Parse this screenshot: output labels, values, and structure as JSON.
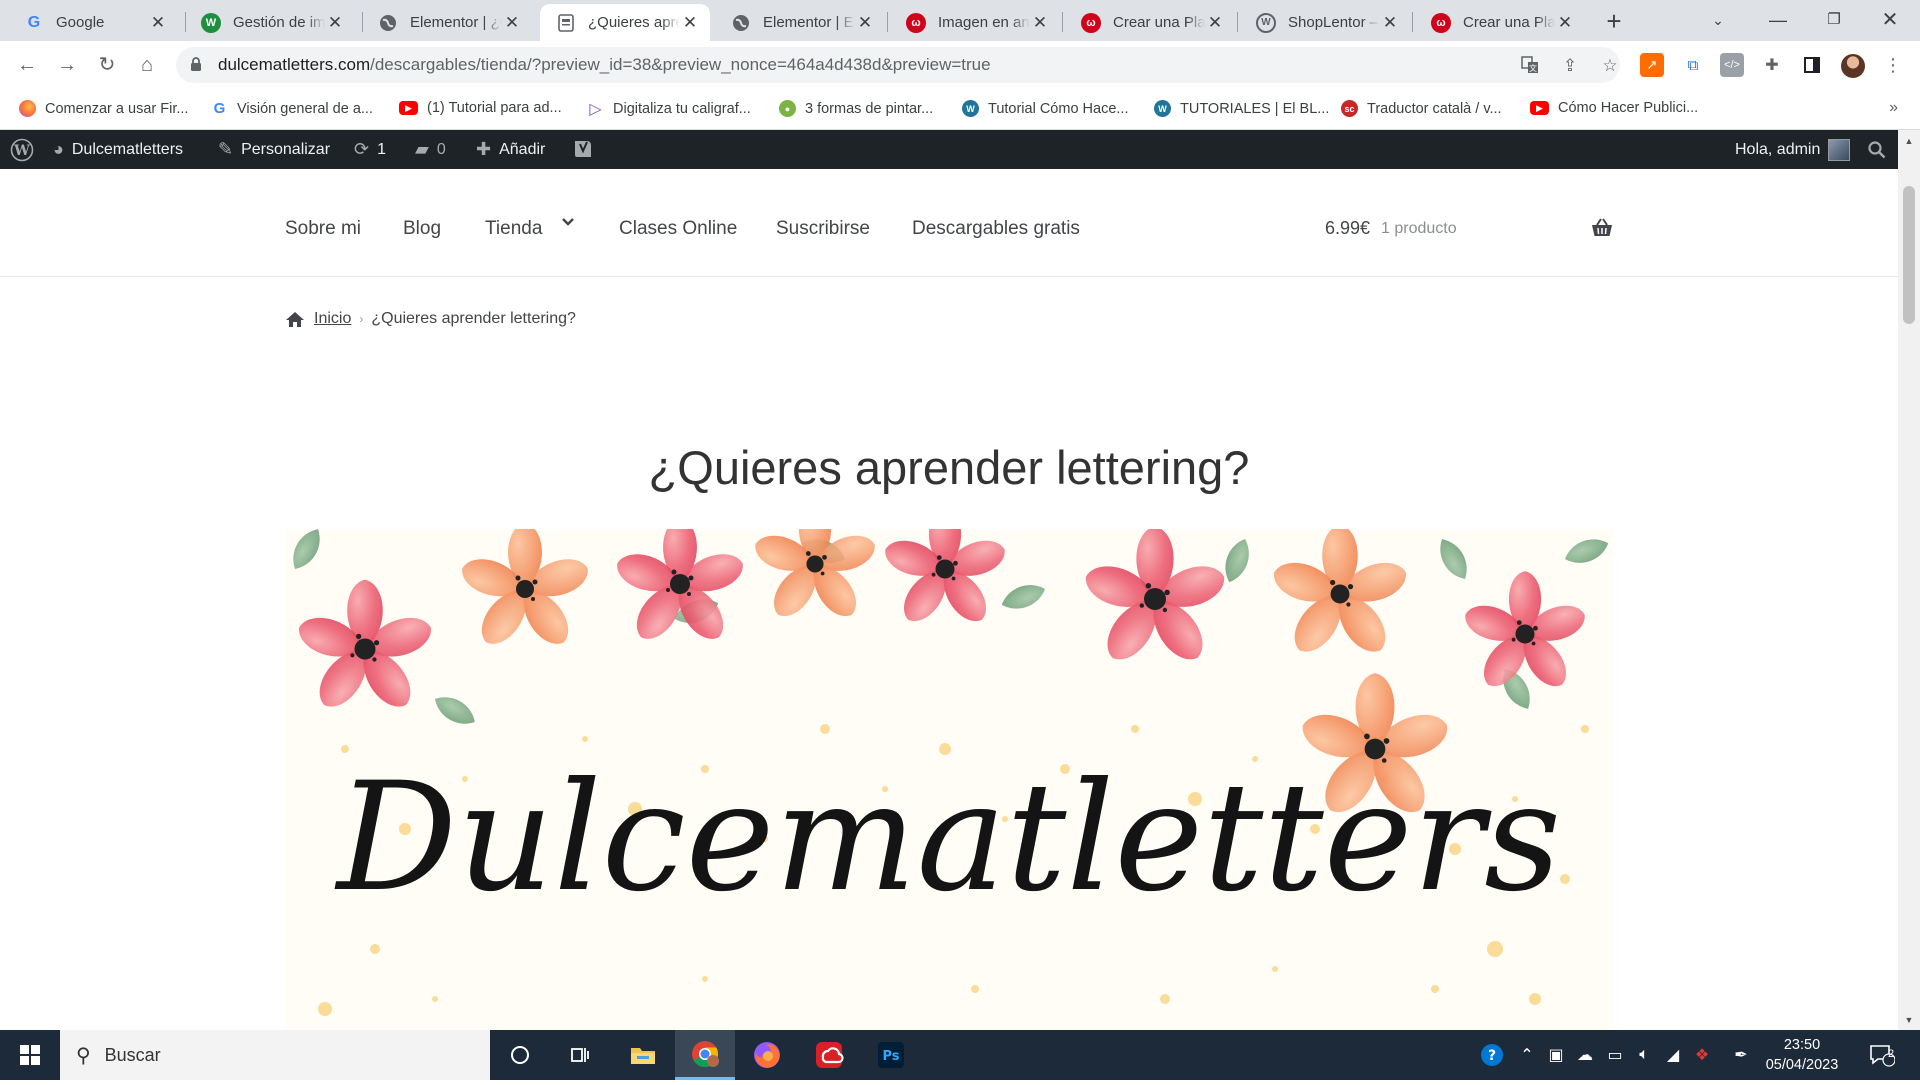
{
  "browser": {
    "tabs": [
      {
        "title": "Google",
        "icon": "google-icon",
        "color": "#4285f4",
        "glyph": "G"
      },
      {
        "title": "Gestión de imágenes",
        "icon": "wpcom-icon",
        "color": "#1e8f3e",
        "glyph": "W"
      },
      {
        "title": "Elementor | ¿Quieres",
        "icon": "globe-icon",
        "color": "#5f6368",
        "glyph": ""
      },
      {
        "title": "¿Quieres aprender lettering?",
        "icon": "page-icon",
        "color": "#5f6368",
        "glyph": "",
        "active": true
      },
      {
        "title": "Elementor | Elementor",
        "icon": "globe-icon",
        "color": "#5f6368",
        "glyph": ""
      },
      {
        "title": "Imagen en ancho",
        "icon": "wix-icon",
        "color": "#d0021b",
        "glyph": "ω"
      },
      {
        "title": "Crear una Plantilla",
        "icon": "wix-icon",
        "color": "#d0021b",
        "glyph": "ω"
      },
      {
        "title": "ShopLentor – WooCommerce",
        "icon": "wordpress-icon",
        "color": "#5f6368",
        "glyph": "W"
      },
      {
        "title": "Crear una Plantilla",
        "icon": "wix-icon",
        "color": "#d0021b",
        "glyph": "ω"
      }
    ],
    "url_host": "dulcematletters.com",
    "url_path": "/descargables/tienda/?preview_id=38&preview_nonce=464a4d438d&preview=true",
    "bookmarks": [
      {
        "label": "Comenzar a usar Fir...",
        "icon": "firefox-icon",
        "color": "#ff7139"
      },
      {
        "label": "Visión general de a...",
        "icon": "google-icon",
        "color": "#4285f4"
      },
      {
        "label": "(1) Tutorial para ad...",
        "icon": "youtube-icon",
        "color": "#ff0000"
      },
      {
        "label": "Digitaliza tu caligraf...",
        "icon": "play-icon",
        "color": "#7e57c2"
      },
      {
        "label": "3 formas de pintar...",
        "icon": "site-icon",
        "color": "#7cb342"
      },
      {
        "label": "Tutorial Cómo Hace...",
        "icon": "wordpress-icon",
        "color": "#21759b"
      },
      {
        "label": "TUTORIALES | El BL...",
        "icon": "wordpress-icon",
        "color": "#21759b"
      },
      {
        "label": "Traductor català / v...",
        "icon": "softcatala-icon",
        "color": "#c62828"
      },
      {
        "label": "Cómo Hacer Publici...",
        "icon": "youtube-icon",
        "color": "#ff0000"
      }
    ]
  },
  "adminbar": {
    "site_name": "Dulcematletters",
    "customize": "Personalizar",
    "updates_count": "1",
    "comments_count": "0",
    "add_new": "Añadir",
    "greeting": "Hola, admin"
  },
  "site": {
    "nav": [
      "Sobre mi",
      "Blog",
      "Tienda",
      "Clases Online",
      "Suscribirse",
      "Descargables gratis"
    ],
    "cart_amount": "6.99€",
    "cart_count": "1 producto",
    "breadcrumb_home": "Inicio",
    "breadcrumb_current": "¿Quieres aprender lettering?",
    "page_title": "¿Quieres aprender lettering?",
    "hero_script_text": "Dulcematletters"
  },
  "taskbar": {
    "search_placeholder": "Buscar",
    "time": "23:50",
    "date": "05/04/2023",
    "notification_count": "2"
  },
  "colors": {
    "wp_admin_bg": "#1d2327",
    "taskbar_bg": "#1c2a3a",
    "text_dark": "#43454b"
  }
}
